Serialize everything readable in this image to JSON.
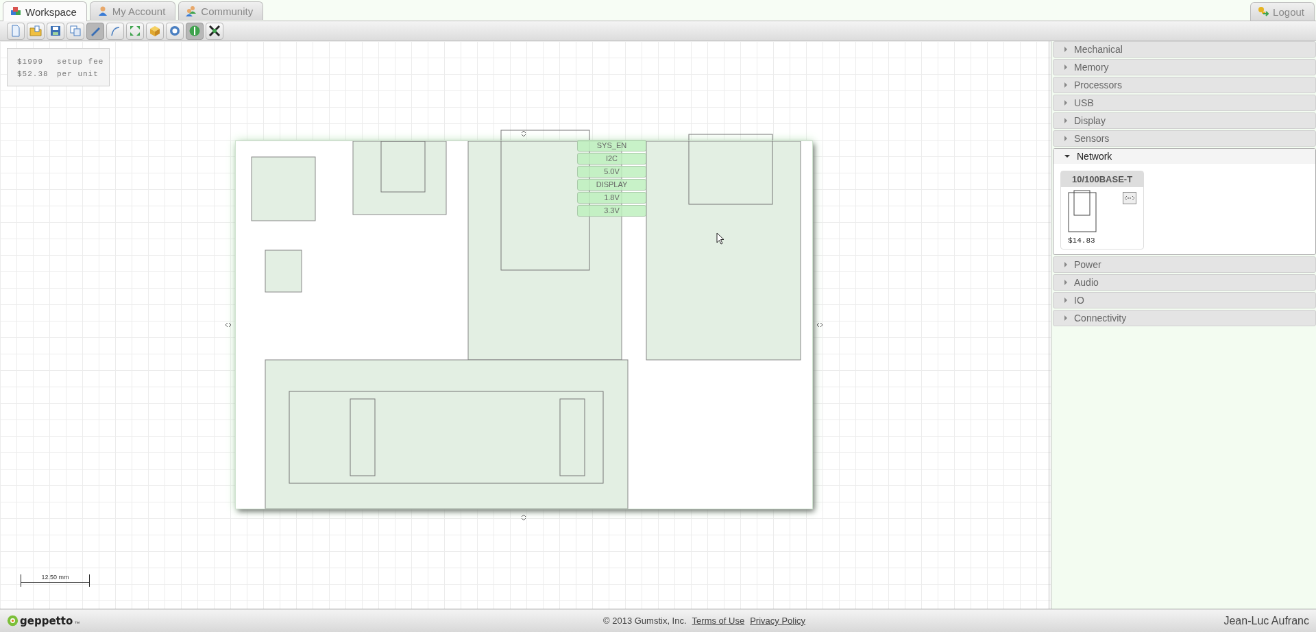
{
  "tabs": [
    {
      "label": "Workspace",
      "selected": true
    },
    {
      "label": "My Account",
      "selected": false
    },
    {
      "label": "Community",
      "selected": false
    }
  ],
  "logout": {
    "label": "Logout"
  },
  "toolbar": [
    {
      "pressed": false
    },
    {
      "pressed": false
    },
    {
      "pressed": false
    },
    {
      "pressed": false
    },
    {
      "pressed": true
    },
    {
      "pressed": false
    },
    {
      "pressed": false
    },
    {
      "pressed": false
    },
    {
      "pressed": false
    },
    {
      "pressed": true
    },
    {
      "pressed": false
    }
  ],
  "cost": {
    "setup_price": "$1999",
    "setup_label": "setup fee",
    "unit_price": "$52.38",
    "unit_label": "per unit"
  },
  "board": {
    "connectors": [
      "SYS_EN",
      "I2C",
      "5.0V",
      "DISPLAY",
      "1.8V",
      "3.3V"
    ]
  },
  "scale_bar": {
    "label": "12.50 mm"
  },
  "sidebar": {
    "categories": [
      {
        "name": "Mechanical",
        "expanded": false
      },
      {
        "name": "Memory",
        "expanded": false
      },
      {
        "name": "Processors",
        "expanded": false
      },
      {
        "name": "USB",
        "expanded": false
      },
      {
        "name": "Display",
        "expanded": false
      },
      {
        "name": "Sensors",
        "expanded": false
      },
      {
        "name": "Network",
        "expanded": true,
        "modules": [
          {
            "name": "10/100BASE-T",
            "price": "$14.83"
          }
        ]
      },
      {
        "name": "Power",
        "expanded": false
      },
      {
        "name": "Audio",
        "expanded": false
      },
      {
        "name": "IO",
        "expanded": false
      },
      {
        "name": "Connectivity",
        "expanded": false
      }
    ]
  },
  "footer": {
    "logo": "geppetto",
    "trademark": "™",
    "copyright": "© 2013 Gumstix, Inc.",
    "links": [
      "Terms of Use",
      "Privacy Policy"
    ],
    "user": "Jean-Luc Aufranc"
  }
}
